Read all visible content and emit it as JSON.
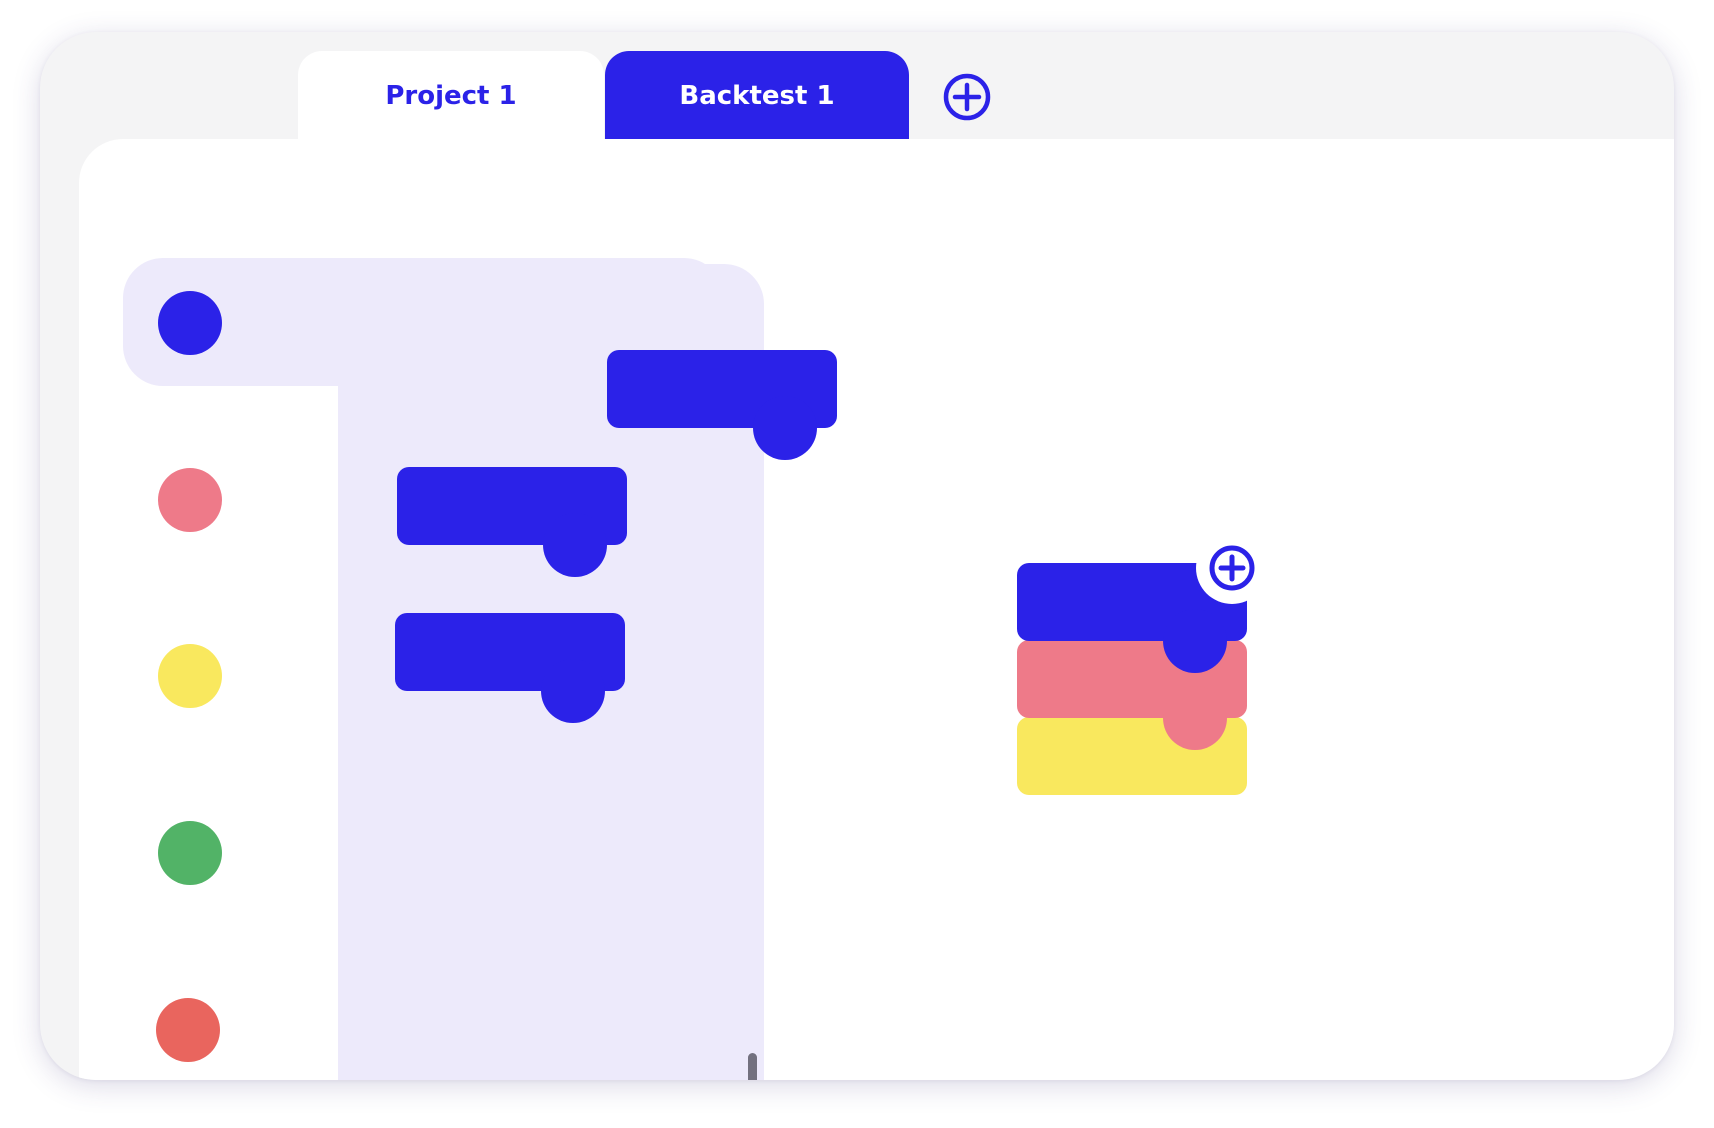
{
  "tabs": [
    {
      "label": "Project 1",
      "active": false
    },
    {
      "label": "Backtest 1",
      "active": true
    }
  ],
  "add_tab_icon": "plus-circle-icon",
  "colors": {
    "accent": "#2b22e8",
    "pink": "#ee7a89",
    "yellow": "#f9e85e",
    "green": "#52b367",
    "red": "#e9655e",
    "flyout_bg": "#edeafb",
    "frame_bg": "#f4f4f5"
  },
  "palette": {
    "categories": [
      "blue",
      "pink",
      "yellow",
      "green",
      "red"
    ],
    "selected": "blue"
  },
  "flyout_blocks": 3,
  "workspace_stack": [
    "blue",
    "pink",
    "yellow"
  ],
  "stack_add_icon": "plus-circle-icon"
}
